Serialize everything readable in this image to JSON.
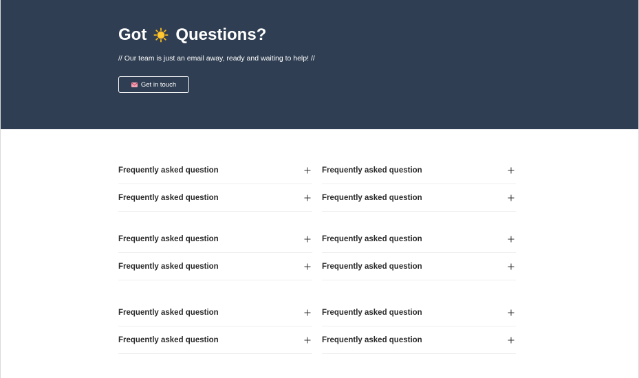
{
  "hero": {
    "title_before": "Got",
    "title_after": "Questions?",
    "title_icon": "sun-icon",
    "subtitle": "// Our team is just an email away, ready and waiting to help! //",
    "cta_label": "Get in touch",
    "cta_icon": "envelope-icon",
    "background": "#2f3e52"
  },
  "faq": {
    "groups": [
      {
        "left": [
          "Frequently asked question",
          "Frequently asked question"
        ],
        "right": [
          "Frequently asked question",
          "Frequently asked question"
        ]
      },
      {
        "left": [
          "Frequently asked question",
          "Frequently asked question"
        ],
        "right": [
          "Frequently asked question",
          "Frequently asked question"
        ]
      },
      {
        "left": [
          "Frequently asked question",
          "Frequently asked question"
        ],
        "right": [
          "Frequently asked question",
          "Frequently asked question"
        ]
      }
    ],
    "toggle_icon": "plus-icon"
  }
}
